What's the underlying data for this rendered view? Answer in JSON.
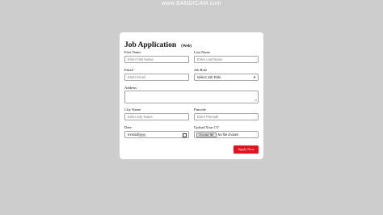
{
  "watermark": "www.BANDICAM.com",
  "form": {
    "title": "Job Application",
    "subtitle": "(Web)",
    "first_name": {
      "label": "First Name",
      "placeholder": "Enter First Name"
    },
    "last_name": {
      "label": "Last Name",
      "placeholder": "Enter Last Name"
    },
    "email": {
      "label": "Email",
      "placeholder": "Enter Email"
    },
    "job_role": {
      "label": "Job Role",
      "selected": "Select Job Role"
    },
    "address": {
      "label": "Address"
    },
    "city": {
      "label": "City Name",
      "placeholder": "Enter City Name"
    },
    "pincode": {
      "label": "Pincode",
      "placeholder": "Enter Pincode"
    },
    "date": {
      "label": "Date",
      "value": "mm/dd/yyyy"
    },
    "cv": {
      "label": "Upload Your CV",
      "button": "Choose file",
      "status": "No file chosen"
    },
    "submit_label": "Apply Now"
  },
  "icons": {
    "select_arrow": "chevron-down-icon",
    "date_picker": "calendar-icon",
    "resize": "resize-grip-icon"
  },
  "colors": {
    "page_background": "#cdcdcd",
    "card_background": "#ffffff",
    "apply_button": "#e8101a"
  }
}
